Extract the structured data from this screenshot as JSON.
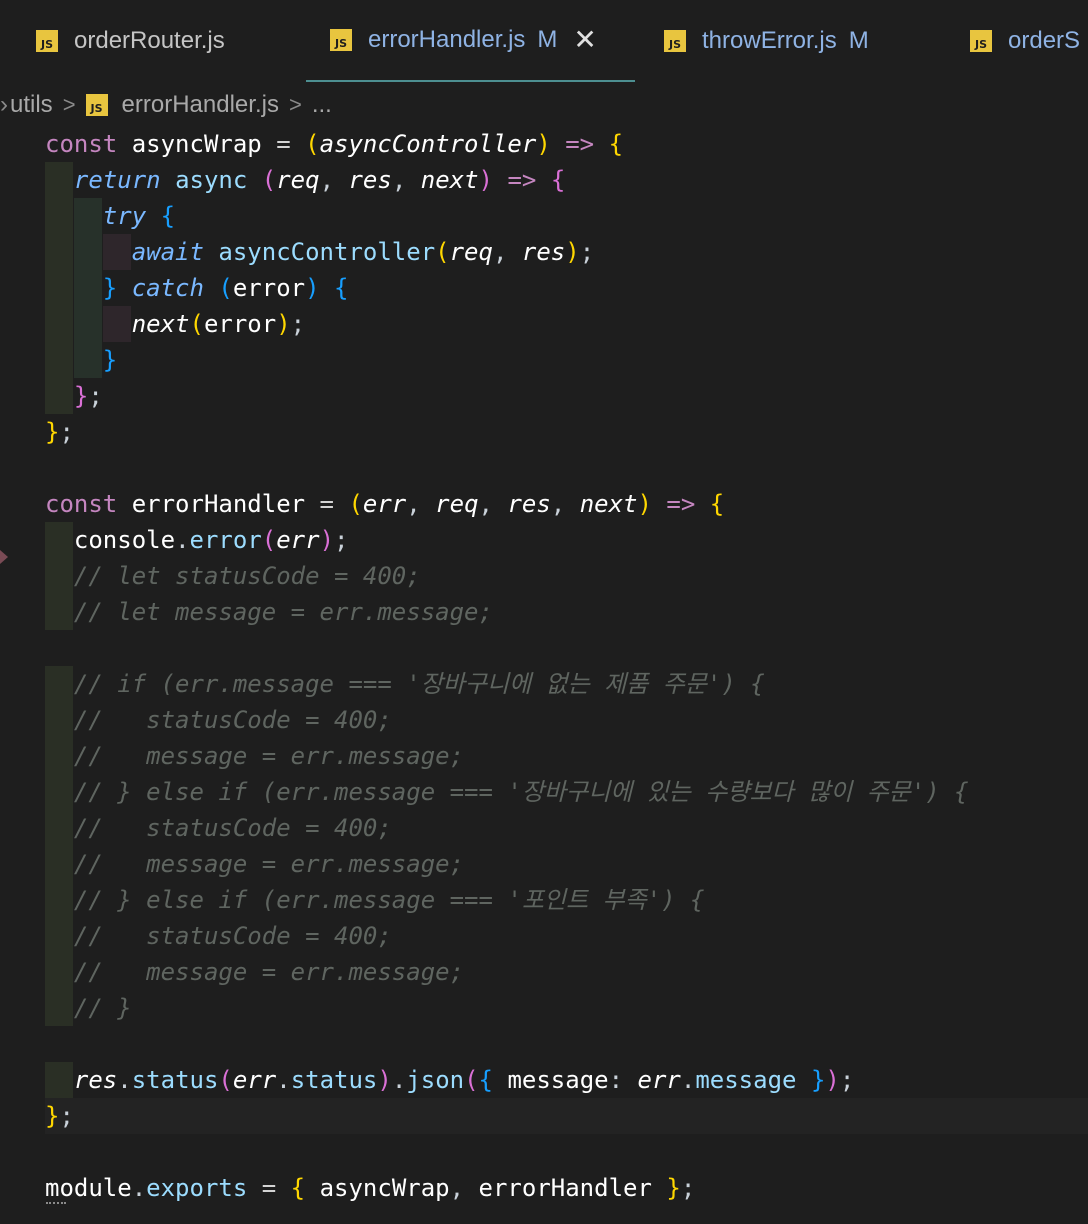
{
  "tabs": [
    {
      "name": "orderRouter.js",
      "badge": "JS",
      "modified": ""
    },
    {
      "name": "errorHandler.js",
      "badge": "JS",
      "modified": "M",
      "close": "✕"
    },
    {
      "name": "throwError.js",
      "badge": "JS",
      "modified": "M"
    },
    {
      "name": "orderS",
      "badge": "JS",
      "modified": ""
    }
  ],
  "breadcrumb": {
    "folder": "utils",
    "sep": ">",
    "badge": "JS",
    "file": "errorHandler.js",
    "more": "..."
  },
  "code_lines": [
    "const asyncWrap = (asyncController) => {",
    "  return async (req, res, next) => {",
    "    try {",
    "      await asyncController(req, res);",
    "    } catch (error) {",
    "      next(error);",
    "    }",
    "  };",
    "};",
    "",
    "const errorHandler = (err, req, res, next) => {",
    "  console.error(err);",
    "  // let statusCode = 400;",
    "  // let message = err.message;",
    "",
    "  // if (err.message === '장바구니에 없는 제품 주문') {",
    "  //   statusCode = 400;",
    "  //   message = err.message;",
    "  // } else if (err.message === '장바구니에 있는 수량보다 많이 주문') {",
    "  //   statusCode = 400;",
    "  //   message = err.message;",
    "  // } else if (err.message === '포인트 부족') {",
    "  //   statusCode = 400;",
    "  //   message = err.message;",
    "  // }",
    "",
    "  res.status(err.status).json({ message: err.message });",
    "};",
    "",
    "module.exports = { asyncWrap, errorHandler };"
  ]
}
